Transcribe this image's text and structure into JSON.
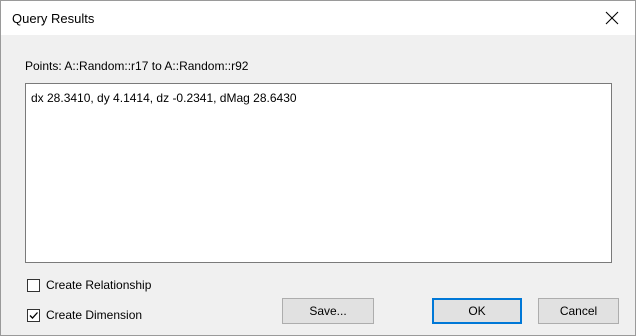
{
  "window": {
    "title": "Query Results"
  },
  "points_label": "Points: A::Random::r17 to A::Random::r92",
  "results_text": "dx 28.3410, dy 4.1414, dz -0.2341, dMag 28.6430",
  "checkboxes": [
    {
      "label": "Create Relationship",
      "checked": false
    },
    {
      "label": "Create Dimension",
      "checked": true
    }
  ],
  "buttons": {
    "save": "Save...",
    "ok": "OK",
    "cancel": "Cancel"
  },
  "colors": {
    "default_button_border": "#0078d7",
    "button_face": "#e1e1e1",
    "dialog_bg": "#f0f0f0"
  },
  "icons": {
    "close": "close-icon",
    "checkmark": "checkmark-icon"
  }
}
